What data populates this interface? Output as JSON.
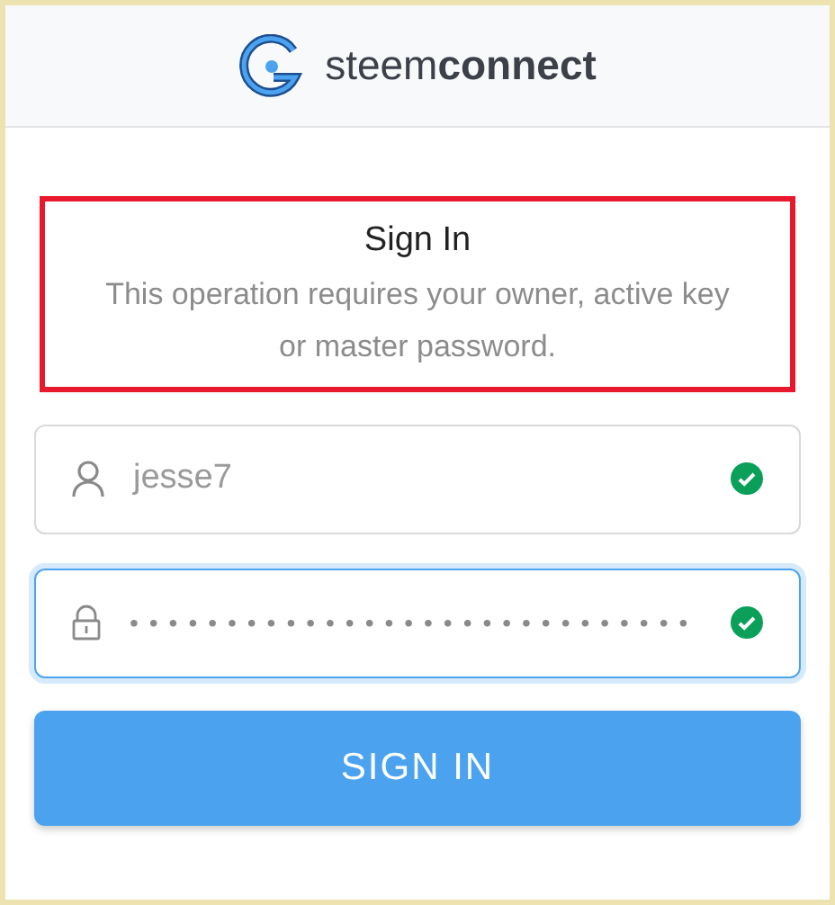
{
  "header": {
    "brand_light": "steem",
    "brand_bold": "connect"
  },
  "notice": {
    "title": "Sign In",
    "message": "This operation requires your owner, active key or master password.",
    "highlighted": true
  },
  "fields": [
    {
      "kind": "user",
      "value": "jesse7",
      "valid": true,
      "focused": false
    },
    {
      "kind": "lock",
      "value": "•••••••••••••••••••••••••••••",
      "valid": true,
      "focused": true
    }
  ],
  "submit": {
    "label": "SIGN IN"
  }
}
